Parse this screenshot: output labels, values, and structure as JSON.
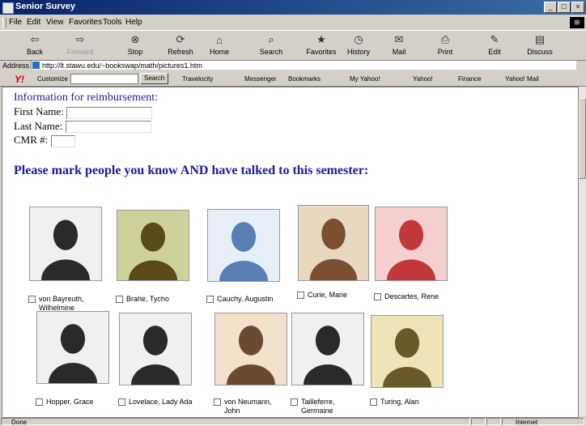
{
  "window": {
    "title": "Senior Survey"
  },
  "menu": [
    "File",
    "Edit",
    "View",
    "Favorites",
    "Tools",
    "Help"
  ],
  "toolbar": [
    {
      "label": "Back",
      "icon": "back-arrow-icon",
      "glyph": "⇦",
      "enabled": true
    },
    {
      "label": "Forward",
      "icon": "forward-arrow-icon",
      "glyph": "⇨",
      "enabled": false
    },
    {
      "label": "Stop",
      "icon": "stop-icon",
      "glyph": "⊗",
      "enabled": true
    },
    {
      "label": "Refresh",
      "icon": "refresh-icon",
      "glyph": "⟳",
      "enabled": true
    },
    {
      "label": "Home",
      "icon": "home-icon",
      "glyph": "⌂",
      "enabled": true
    },
    {
      "label": "Search",
      "icon": "search-icon",
      "glyph": "⌕",
      "enabled": true
    },
    {
      "label": "Favorites",
      "icon": "favorites-icon",
      "glyph": "★",
      "enabled": true
    },
    {
      "label": "History",
      "icon": "history-icon",
      "glyph": "◷",
      "enabled": true
    },
    {
      "label": "Mail",
      "icon": "mail-icon",
      "glyph": "✉",
      "enabled": true
    },
    {
      "label": "Print",
      "icon": "print-icon",
      "glyph": "⎙",
      "enabled": true
    },
    {
      "label": "Edit",
      "icon": "edit-icon",
      "glyph": "✎",
      "enabled": true
    },
    {
      "label": "Discuss",
      "icon": "discuss-icon",
      "glyph": "▤",
      "enabled": true
    }
  ],
  "address": {
    "label": "Address",
    "url": "http://lt.stawu.edu/~bookswap/math/pictures1.htm"
  },
  "yahoo": {
    "logo": "Y!",
    "customize": "Customize",
    "search_button": "Search",
    "links": [
      "Travelocity",
      "Messenger",
      "Bookmarks",
      "My Yahoo!",
      "Yahoo!",
      "Finance",
      "Yahoo! Mail"
    ]
  },
  "form": {
    "heading": "Information for reimbursement:",
    "first_name_label": "First Name:",
    "last_name_label": "Last Name:",
    "cmr_label": "CMR #:"
  },
  "prompt": "Please mark people you know AND have talked to this semester:",
  "people": [
    {
      "name": "von Bayreuth, Wilhelmine",
      "tone": "bw"
    },
    {
      "name": "Brahe, Tycho",
      "tone": "olive"
    },
    {
      "name": "Cauchy, Augustin",
      "tone": "blue"
    },
    {
      "name": "Curie, Marie",
      "tone": "color"
    },
    {
      "name": "Descartes, Rene",
      "tone": "red"
    },
    {
      "name": "Hopper, Grace",
      "tone": "bw"
    },
    {
      "name": "Lovelace, Lady Ada",
      "tone": "bw"
    },
    {
      "name": "von Neumann, John",
      "tone": "sepia"
    },
    {
      "name": "Tailleferre, Germaine",
      "tone": "bw"
    },
    {
      "name": "Turing, Alan",
      "tone": "gold"
    }
  ],
  "status": {
    "text": "Done",
    "zone": "Internet"
  }
}
